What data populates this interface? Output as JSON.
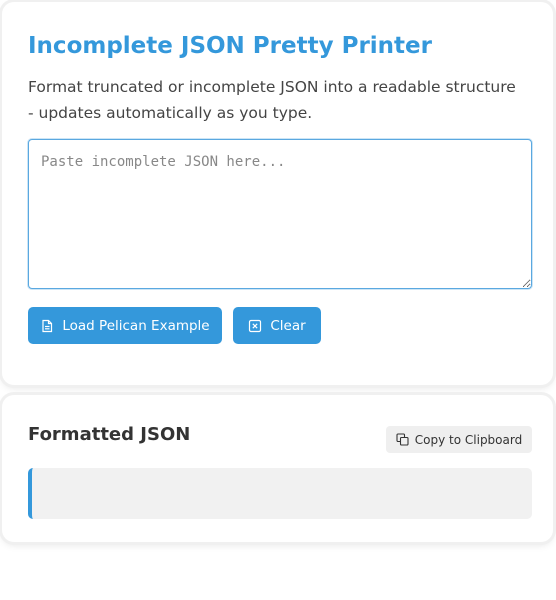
{
  "header": {
    "title": "Incomplete JSON Pretty Printer",
    "subtitle": "Format truncated or incomplete JSON into a readable structure - updates automatically as you type."
  },
  "input": {
    "placeholder": "Paste incomplete JSON here...",
    "value": ""
  },
  "actions": {
    "load_example_label": "Load Pelican Example",
    "clear_label": "Clear"
  },
  "output": {
    "title": "Formatted JSON",
    "copy_label": "Copy to Clipboard",
    "content": ""
  },
  "colors": {
    "accent": "#3498db",
    "heading": "#333333",
    "output_background": "#f1f1f1"
  },
  "icons": {
    "load_example": "document-icon",
    "clear": "x-square-icon",
    "copy": "copy-icon"
  }
}
